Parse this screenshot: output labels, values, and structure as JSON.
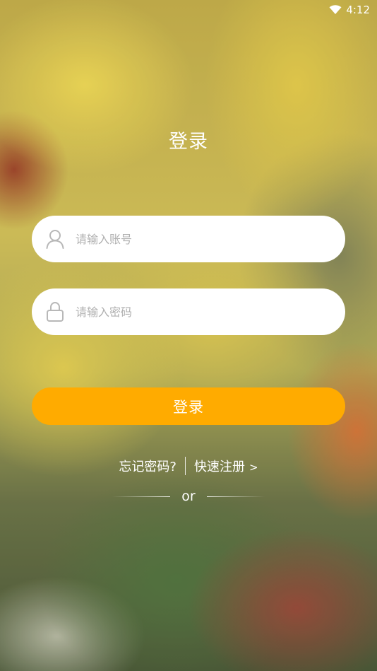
{
  "status_bar": {
    "time": "4:12",
    "wifi_icon": "wifi-icon"
  },
  "title": "登录",
  "account_field": {
    "icon": "user-icon",
    "placeholder": "请输入账号",
    "value": ""
  },
  "password_field": {
    "icon": "lock-icon",
    "placeholder": "请输入密码",
    "value": ""
  },
  "login_button": {
    "label": "登录",
    "color": "#ffab00"
  },
  "links": {
    "forgot_password": "忘记密码?",
    "register": "快速注册",
    "register_arrow": ">"
  },
  "separator": {
    "text": "or"
  }
}
